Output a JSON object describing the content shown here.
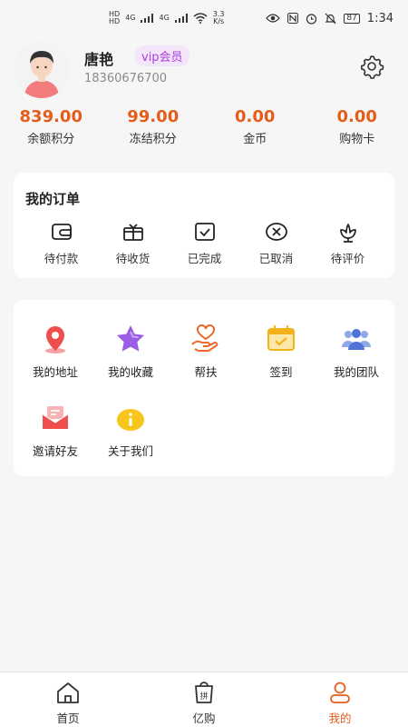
{
  "status_bar": {
    "hd1": "HD",
    "hd2": "HD",
    "net1": "4G",
    "net2": "4G",
    "speed": "3.3",
    "speed_unit": "K/s",
    "battery": "87",
    "time": "1:34"
  },
  "profile": {
    "name": "唐艳",
    "badge": "vip会员",
    "phone": "18360676700"
  },
  "stats": [
    {
      "value": "839.00",
      "label": "余额积分"
    },
    {
      "value": "99.00",
      "label": "冻结积分"
    },
    {
      "value": "0.00",
      "label": "金币"
    },
    {
      "value": "0.00",
      "label": "购物卡"
    }
  ],
  "orders": {
    "title": "我的订单",
    "items": [
      {
        "label": "待付款",
        "icon": "wallet-icon"
      },
      {
        "label": "待收货",
        "icon": "gift-box-icon"
      },
      {
        "label": "已完成",
        "icon": "check-box-icon"
      },
      {
        "label": "已取消",
        "icon": "cancel-icon"
      },
      {
        "label": "待评价",
        "icon": "flower-icon"
      }
    ]
  },
  "services": [
    {
      "label": "我的地址",
      "icon": "location-pin-icon"
    },
    {
      "label": "我的收藏",
      "icon": "star-icon"
    },
    {
      "label": "帮扶",
      "icon": "heart-hand-icon"
    },
    {
      "label": "签到",
      "icon": "calendar-check-icon"
    },
    {
      "label": "我的团队",
      "icon": "team-icon"
    },
    {
      "label": "邀请好友",
      "icon": "envelope-icon"
    },
    {
      "label": "关于我们",
      "icon": "info-icon"
    }
  ],
  "tabs": [
    {
      "label": "首页",
      "icon": "home-icon"
    },
    {
      "label": "亿购",
      "icon": "shopping-bag-icon",
      "glyph": "拼"
    },
    {
      "label": "我的",
      "icon": "profile-icon"
    }
  ],
  "colors": {
    "accent": "#e55d1b",
    "vip_text": "#b03ae0",
    "vip_bg": "#f3e6fb"
  }
}
